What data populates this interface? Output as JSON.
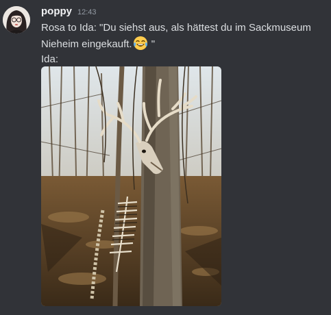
{
  "message": {
    "username": "poppy",
    "timestamp": "12:43",
    "line1": "Rosa to Ida: \"Du siehst aus, als hättest du im Sackmuseum",
    "line2_before": "Nieheim eingekauft.",
    "line2_emoji": "joy-emoji",
    "line2_after": " \"",
    "line3": "Ida:"
  },
  "colors": {
    "background": "#313338",
    "username": "#f2f3f5",
    "timestamp": "#949ba4",
    "text": "#dbdee1"
  },
  "attachment": {
    "kind": "photo",
    "alt": ""
  }
}
